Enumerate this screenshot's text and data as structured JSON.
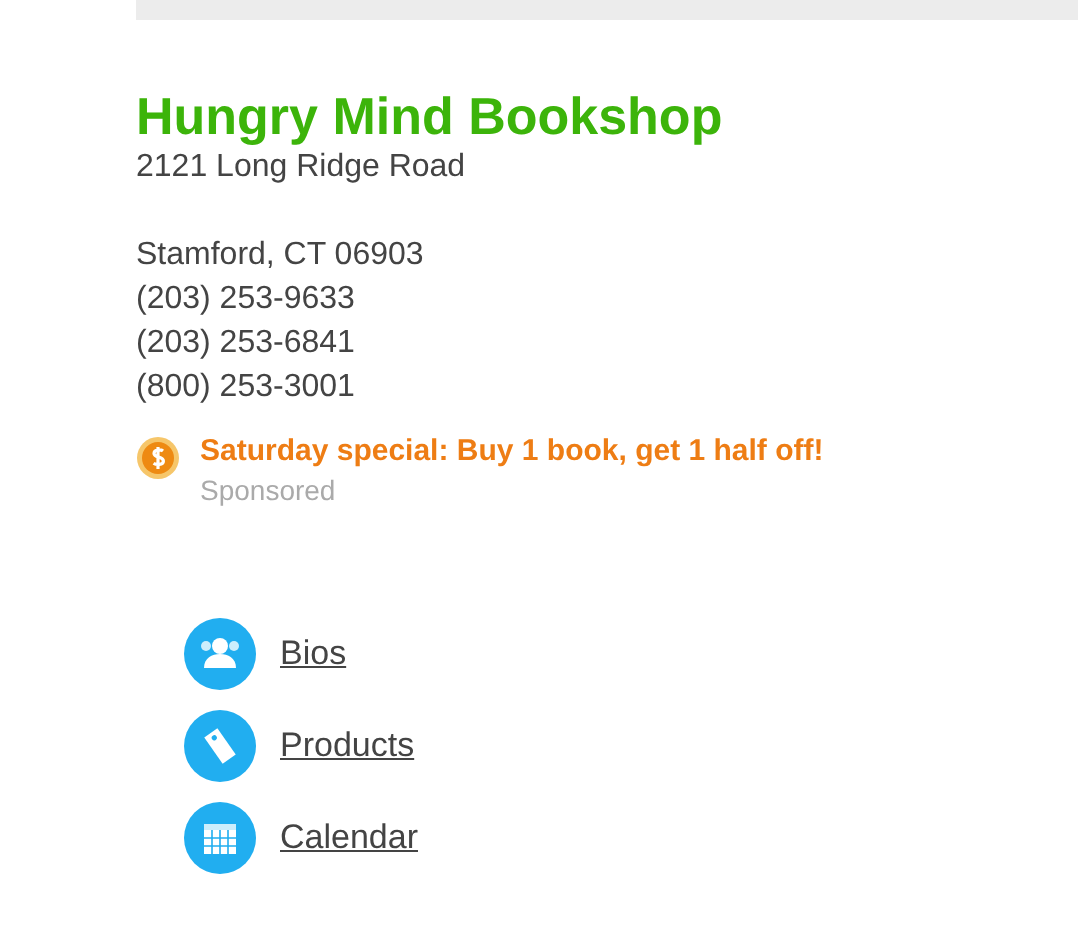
{
  "business": {
    "name": "Hungry Mind Bookshop",
    "street": "2121 Long Ridge Road",
    "city": "Stamford, CT 06903",
    "phones": [
      "(203) 253-9633",
      "(203) 253-6841",
      "(800) 253-3001"
    ]
  },
  "promo": {
    "text": "Saturday special: Buy 1 book, get 1 half off!",
    "label": "Sponsored"
  },
  "links": [
    {
      "label": "Bios"
    },
    {
      "label": "Products"
    },
    {
      "label": "Calendar"
    }
  ]
}
